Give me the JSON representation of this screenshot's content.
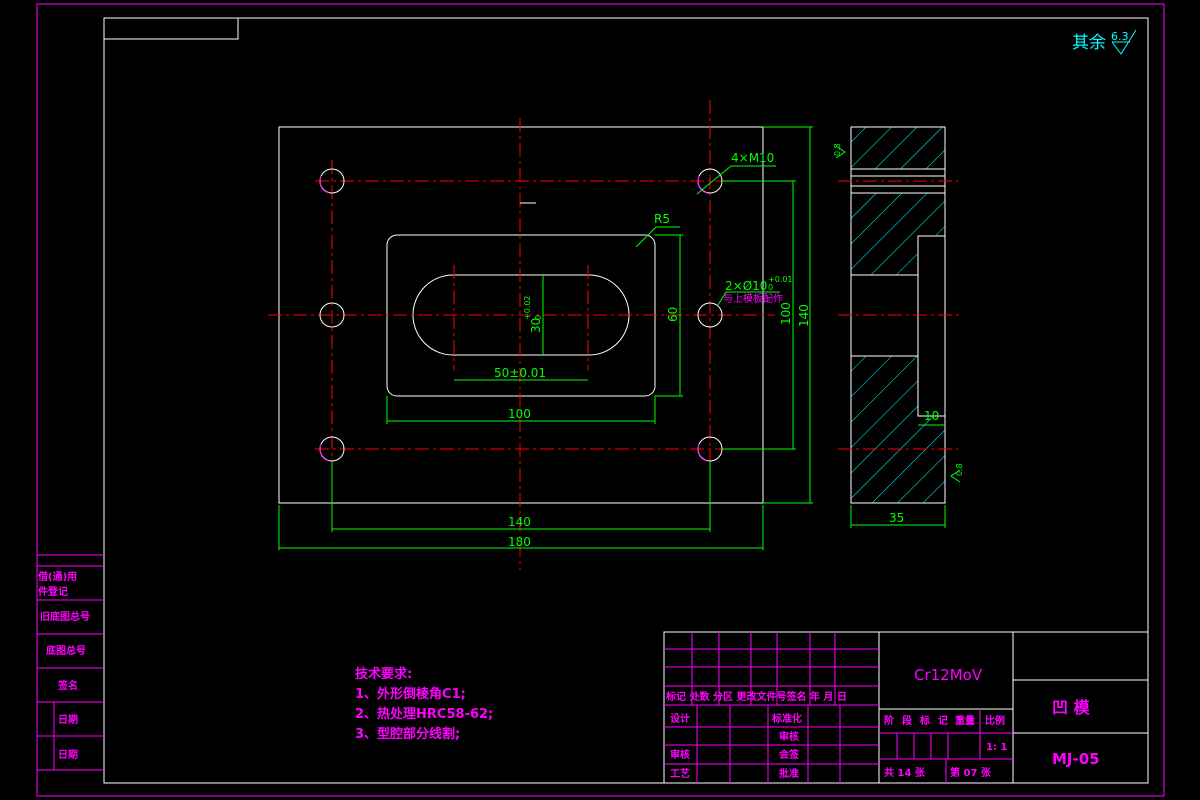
{
  "roughness_note": {
    "prefix": "其余",
    "value": "6.3"
  },
  "front_view": {
    "dims": {
      "width_overall": "180",
      "hole_spacing_x": "140",
      "height_overall": "140",
      "hole_spacing_y": "100",
      "cavity_width": "100",
      "cavity_height": "60",
      "slot_length": "50±0.01",
      "slot_width": "30",
      "slot_width_tol": "+0.02",
      "slot_width_tol_low": "0",
      "dowel_tol": "+0.01",
      "dowel_tol_low": "0"
    },
    "notes": {
      "corner_radius": "R5",
      "screw_holes": "4×M10",
      "dowel_holes": "2×Ø10",
      "dowel_note": "与上模板配作"
    }
  },
  "side_view": {
    "dims": {
      "thickness": "35",
      "pocket_depth": "10"
    },
    "roughness": {
      "top": "0.8",
      "bottom": "0.8"
    }
  },
  "left_stamp": [
    "借(通)用",
    "件登记",
    "旧底图总号",
    "底图总号",
    "签名",
    "日期",
    "日期"
  ],
  "tech_requirements": {
    "title": "技术要求:",
    "items": [
      "1、外形倒棱角C1;",
      "2、热处理HRC58-62;",
      "3、型腔部分线割;"
    ]
  },
  "title_block": {
    "material": "Cr12MoV",
    "part_name": "凹  模",
    "drawing_number": "MJ-05",
    "scale": "1: 1",
    "sheet_total": "共 14 张",
    "sheet_current": "第 07 张",
    "stage_header": [
      "阶",
      "段",
      "标",
      "记",
      "重量",
      "比例"
    ],
    "revision_header": "标记 处数 分区 更改文件号签名 年 月 日",
    "roles": {
      "design": "设计",
      "standardize": "标准化",
      "check": "审核",
      "review": "审核",
      "process": "工艺",
      "approve": "批准",
      "audit": "会签"
    }
  }
}
